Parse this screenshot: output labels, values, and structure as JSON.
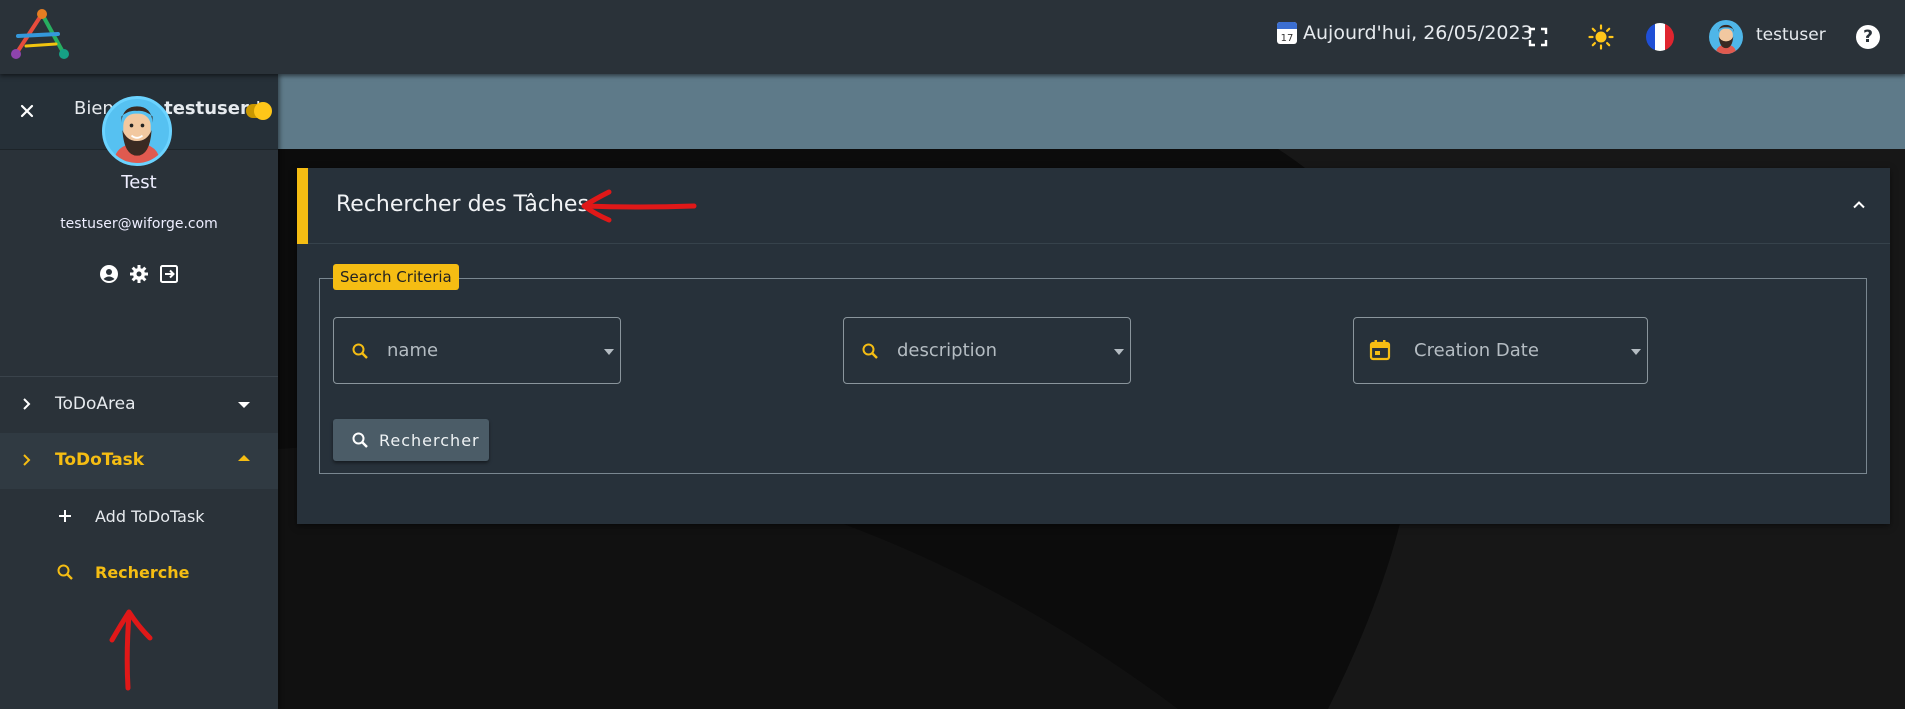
{
  "topbar": {
    "date_text": "Aujourd'hui, 26/05/2023",
    "calendar_day": "17",
    "username": "testuser",
    "help_label": "?",
    "flag_colors": [
      "#1f4fd6",
      "#ffffff",
      "#e0252f"
    ]
  },
  "sidebar": {
    "welcome_prefix": "Bienvenu",
    "welcome_user": "testuser",
    "welcome_suffix": "!",
    "profile_name": "Test",
    "profile_email": "testuser@wiforge.com",
    "menu": [
      {
        "label": "ToDoArea",
        "expanded": false
      },
      {
        "label": "ToDoTask",
        "expanded": true,
        "active": true
      }
    ],
    "submenu": [
      {
        "label": "Add ToDoTask",
        "icon": "plus-icon"
      },
      {
        "label": "Recherche",
        "icon": "search-icon",
        "active": true
      }
    ]
  },
  "main": {
    "card_title": "Rechercher des Tâches",
    "criteria_legend": "Search Criteria",
    "fields": [
      {
        "placeholder": "name",
        "icon": "search-icon"
      },
      {
        "placeholder": "description",
        "icon": "search-icon"
      },
      {
        "placeholder": "Creation Date",
        "icon": "calendar-icon"
      }
    ],
    "search_button": "Rechercher"
  },
  "colors": {
    "accent": "#f5bd13",
    "topbar_bg": "#2a3239",
    "banner_bg": "#5e7a89",
    "annotation_arrow": "#e01818"
  }
}
